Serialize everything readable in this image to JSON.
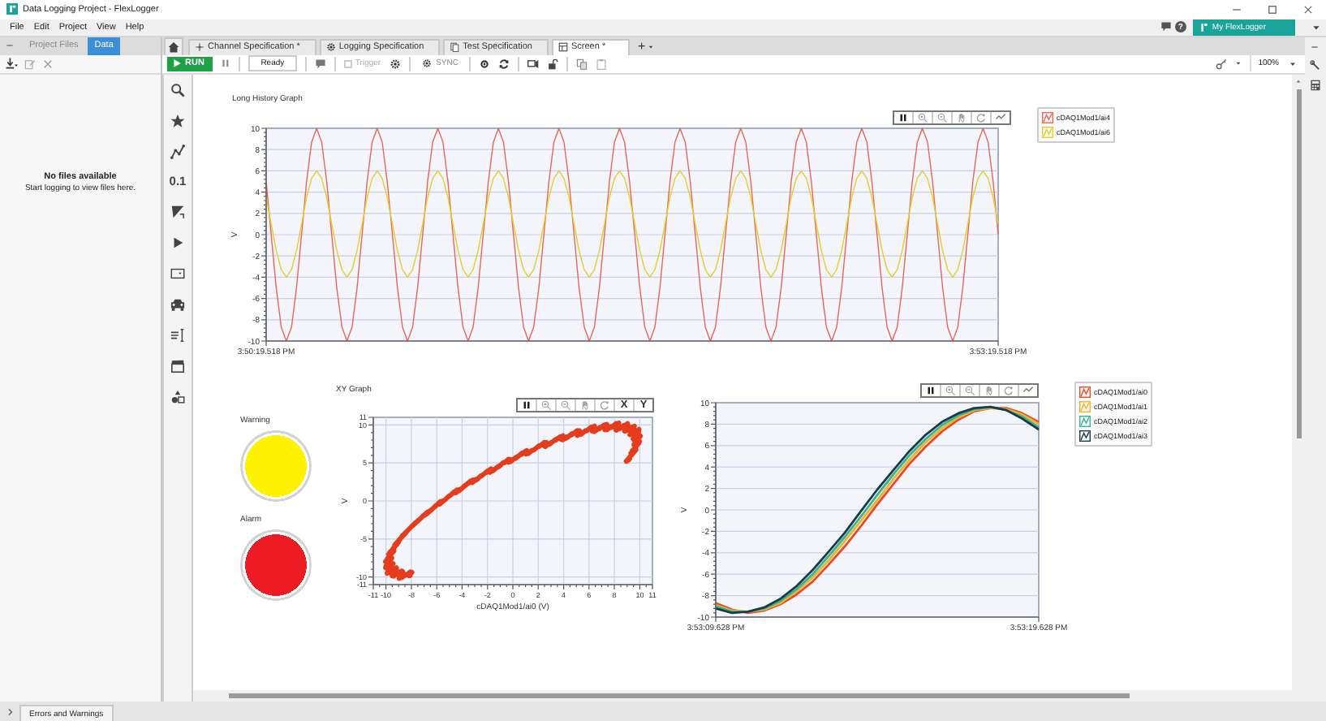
{
  "window": {
    "title": "Data Logging Project - FlexLogger"
  },
  "menu": [
    "File",
    "Edit",
    "Project",
    "View",
    "Help"
  ],
  "header": {
    "help": "?",
    "account_button": "My FlexLogger"
  },
  "side_panel": {
    "tabs": [
      {
        "label": "Project Files",
        "selected": false
      },
      {
        "label": "Data",
        "selected": true
      }
    ],
    "empty_title": "No files available",
    "empty_hint": "Start logging to view files here."
  },
  "document_tabs": [
    {
      "kind": "channels",
      "label": "Channel Specification *",
      "selected": false
    },
    {
      "kind": "logging",
      "label": "Logging Specification",
      "selected": false
    },
    {
      "kind": "test",
      "label": "Test Specification",
      "selected": false
    },
    {
      "kind": "screen",
      "label": "Screen *",
      "selected": true
    }
  ],
  "new_tab": "+",
  "toolbar": {
    "run": "RUN",
    "status": "Ready",
    "trigger": {
      "label": "Trigger",
      "checked": false,
      "disabled": true
    },
    "sync": {
      "label": "SYNC",
      "disabled": true
    },
    "zoom": "100%"
  },
  "palette": [
    {
      "kind": "search"
    },
    {
      "kind": "favorites"
    },
    {
      "kind": "graph"
    },
    {
      "kind": "numeric",
      "label": "0.1"
    },
    {
      "kind": "gauge"
    },
    {
      "kind": "button"
    },
    {
      "kind": "dropdown"
    },
    {
      "kind": "vehicle"
    },
    {
      "kind": "text"
    },
    {
      "kind": "media"
    },
    {
      "kind": "shapes"
    }
  ],
  "screen": {
    "widgets": [
      {
        "kind": "graph",
        "title": "Long History Graph",
        "chart_data": {
          "type": "line",
          "ylabel": "V",
          "ylim": [
            -10,
            10
          ],
          "yticks": [
            10,
            8,
            6,
            4,
            2,
            0,
            -2,
            -4,
            -6,
            -8,
            -10
          ],
          "grid": true,
          "categories": [
            "3:50:19.518 PM",
            null,
            null,
            null,
            null,
            null,
            null,
            null,
            null,
            null,
            null,
            null,
            null,
            null,
            null,
            null,
            null,
            null,
            null,
            null,
            null,
            null,
            null,
            null,
            null,
            null,
            null,
            null,
            null,
            null,
            null,
            null,
            null,
            null,
            null,
            null,
            null,
            null,
            null,
            null,
            null,
            null,
            null,
            null,
            null,
            null,
            null,
            null,
            null,
            null,
            null,
            null,
            null,
            null,
            null,
            null,
            null,
            null,
            null,
            null,
            null,
            null,
            null,
            null,
            null,
            null,
            null,
            null,
            null,
            null,
            null,
            null,
            null,
            null,
            null,
            null,
            null,
            null,
            null,
            null,
            null,
            null,
            null,
            null,
            null,
            null,
            null,
            null,
            null,
            null,
            null,
            null,
            null,
            null,
            null,
            null,
            null,
            null,
            null,
            null,
            null,
            null,
            null,
            null,
            null,
            null,
            null,
            null,
            null,
            null,
            null,
            null,
            null,
            null,
            null,
            null,
            null,
            null,
            null,
            null,
            null,
            null,
            null,
            null,
            null,
            null,
            null,
            null,
            null,
            null,
            null,
            null,
            null,
            null,
            null,
            null,
            null,
            null,
            null,
            null,
            null,
            null,
            null,
            null,
            null,
            "3:53:19.518 PM"
          ],
          "series": [
            {
              "name": "cDAQ1Mod1/ai4",
              "color": "#e8675a",
              "values": [
                5,
                0,
                -5,
                -8.7,
                -10,
                -8.7,
                -5,
                0,
                5,
                8.7,
                10,
                8.7,
                5,
                0,
                -5,
                -8.7,
                -10,
                -8.7,
                -5,
                0,
                5,
                8.7,
                10,
                8.7,
                5,
                0,
                -5,
                -8.7,
                -10,
                -8.7,
                -5,
                0,
                5,
                8.7,
                10,
                8.7,
                5,
                0,
                -5,
                -8.7,
                -10,
                -8.7,
                -5,
                0,
                5,
                8.7,
                10,
                8.7,
                5,
                0,
                -5,
                -8.7,
                -10,
                -8.7,
                -5,
                0,
                5,
                8.7,
                10,
                8.7,
                5,
                0,
                -5,
                -8.7,
                -10,
                -8.7,
                -5,
                0,
                5,
                8.7,
                10,
                8.7,
                5,
                0,
                -5,
                -8.7,
                -10,
                -8.7,
                -5,
                0,
                5,
                8.7,
                10,
                8.7,
                5,
                0,
                -5,
                -8.7,
                -10,
                -8.7,
                -5,
                0,
                5,
                8.7,
                10,
                8.7,
                5,
                0,
                -5,
                -8.7,
                -10,
                -8.7,
                -5,
                0,
                5,
                8.7,
                10,
                8.7,
                5,
                0,
                -5,
                -8.7,
                -10,
                -8.7,
                -5,
                0,
                5,
                8.7,
                10,
                8.7,
                5,
                0,
                -5,
                -8.7,
                -10,
                -8.7,
                -5,
                0,
                5,
                8.7,
                10,
                8.7,
                5,
                0,
                -5,
                -8.7,
                -10,
                -8.7,
                -5,
                0,
                5,
                8.7,
                10,
                8.7,
                5,
                0
              ]
            },
            {
              "name": "cDAQ1Mod1/ai6",
              "color": "#e3cf2f",
              "values": [
                3.5,
                1,
                -1.5,
                -3.3,
                -4,
                -3.3,
                -1.5,
                1,
                3.5,
                5.3,
                6,
                5.3,
                3.5,
                1,
                -1.5,
                -3.3,
                -4,
                -3.3,
                -1.5,
                1,
                3.5,
                5.3,
                6,
                5.3,
                3.5,
                1,
                -1.5,
                -3.3,
                -4,
                -3.3,
                -1.5,
                1,
                3.5,
                5.3,
                6,
                5.3,
                3.5,
                1,
                -1.5,
                -3.3,
                -4,
                -3.3,
                -1.5,
                1,
                3.5,
                5.3,
                6,
                5.3,
                3.5,
                1,
                -1.5,
                -3.3,
                -4,
                -3.3,
                -1.5,
                1,
                3.5,
                5.3,
                6,
                5.3,
                3.5,
                1,
                -1.5,
                -3.3,
                -4,
                -3.3,
                -1.5,
                1,
                3.5,
                5.3,
                6,
                5.3,
                3.5,
                1,
                -1.5,
                -3.3,
                -4,
                -3.3,
                -1.5,
                1,
                3.5,
                5.3,
                6,
                5.3,
                3.5,
                1,
                -1.5,
                -3.3,
                -4,
                -3.3,
                -1.5,
                1,
                3.5,
                5.3,
                6,
                5.3,
                3.5,
                1,
                -1.5,
                -3.3,
                -4,
                -3.3,
                -1.5,
                1,
                3.5,
                5.3,
                6,
                5.3,
                3.5,
                1,
                -1.5,
                -3.3,
                -4,
                -3.3,
                -1.5,
                1,
                3.5,
                5.3,
                6,
                5.3,
                3.5,
                1,
                -1.5,
                -3.3,
                -4,
                -3.3,
                -1.5,
                1,
                3.5,
                5.3,
                6,
                5.3,
                3.5,
                1,
                -1.5,
                -3.3,
                -4,
                -3.3,
                -1.5,
                1,
                3.5,
                5.3,
                6,
                5.3,
                3.5,
                1
              ]
            }
          ]
        }
      },
      {
        "kind": "led",
        "label": "Warning",
        "color": "#fff200"
      },
      {
        "kind": "led",
        "label": "Alarm",
        "color": "#ed1c24"
      },
      {
        "kind": "xy_graph",
        "title": "XY Graph",
        "y_label": "V",
        "x_label": "cDAQ1Mod1/ai0 (V)",
        "y_ticks": [
          "11",
          "10",
          "5",
          "0",
          "-5",
          "-10",
          "-11"
        ],
        "x_ticks": [
          "-11",
          "-10",
          "-8",
          "-6",
          "-4",
          "-2",
          "0",
          "2",
          "4",
          "6",
          "8",
          "10",
          "11"
        ],
        "axis_buttons": [
          "X",
          "Y"
        ]
      },
      {
        "kind": "graph",
        "chart_data": {
          "type": "line",
          "ylabel": "V",
          "ylim": [
            -10,
            10
          ],
          "yticks": [
            10,
            8,
            6,
            4,
            2,
            0,
            -2,
            -4,
            -6,
            -8,
            -10
          ],
          "grid": true,
          "categories": [
            "3:53:09.628 PM",
            null,
            null,
            null,
            null,
            null,
            null,
            null,
            null,
            null,
            null,
            null,
            null,
            null,
            null,
            null,
            null,
            null,
            null,
            null,
            "3:53:19.628 PM"
          ],
          "series": [
            {
              "name": "cDAQ1Mod1/ai0",
              "color": "#e84a2a",
              "values": [
                -8.7,
                -9.3,
                -9.6,
                -9.4,
                -8.8,
                -7.9,
                -6.7,
                -5.1,
                -3.4,
                -1.5,
                0.5,
                2.4,
                4.3,
                5.9,
                7.3,
                8.4,
                9.2,
                9.5,
                9.5,
                9.0,
                8.2
              ]
            },
            {
              "name": "cDAQ1Mod1/ai1",
              "color": "#f0b429",
              "values": [
                -8.9,
                -9.4,
                -9.5,
                -9.3,
                -8.7,
                -7.6,
                -6.3,
                -4.7,
                -2.9,
                -1.0,
                0.9,
                2.9,
                4.7,
                6.3,
                7.6,
                8.6,
                9.3,
                9.5,
                9.4,
                8.9,
                8.0
              ]
            },
            {
              "name": "cDAQ1Mod1/ai2",
              "color": "#35b597",
              "values": [
                -9.0,
                -9.5,
                -9.5,
                -9.2,
                -8.5,
                -7.4,
                -6.0,
                -4.3,
                -2.5,
                -0.6,
                1.4,
                3.3,
                5.1,
                6.6,
                7.9,
                8.8,
                9.4,
                9.6,
                9.3,
                8.7,
                7.7
              ]
            },
            {
              "name": "cDAQ1Mod1/ai3",
              "color": "#1c3b4a",
              "values": [
                -9.2,
                -9.6,
                -9.5,
                -9.1,
                -8.3,
                -7.1,
                -5.6,
                -3.9,
                -2.1,
                -0.1,
                1.9,
                3.7,
                5.5,
                7.0,
                8.2,
                9.0,
                9.5,
                9.6,
                9.3,
                8.5,
                7.5
              ]
            }
          ]
        }
      }
    ]
  },
  "status_bar": {
    "label": "Errors and Warnings"
  }
}
